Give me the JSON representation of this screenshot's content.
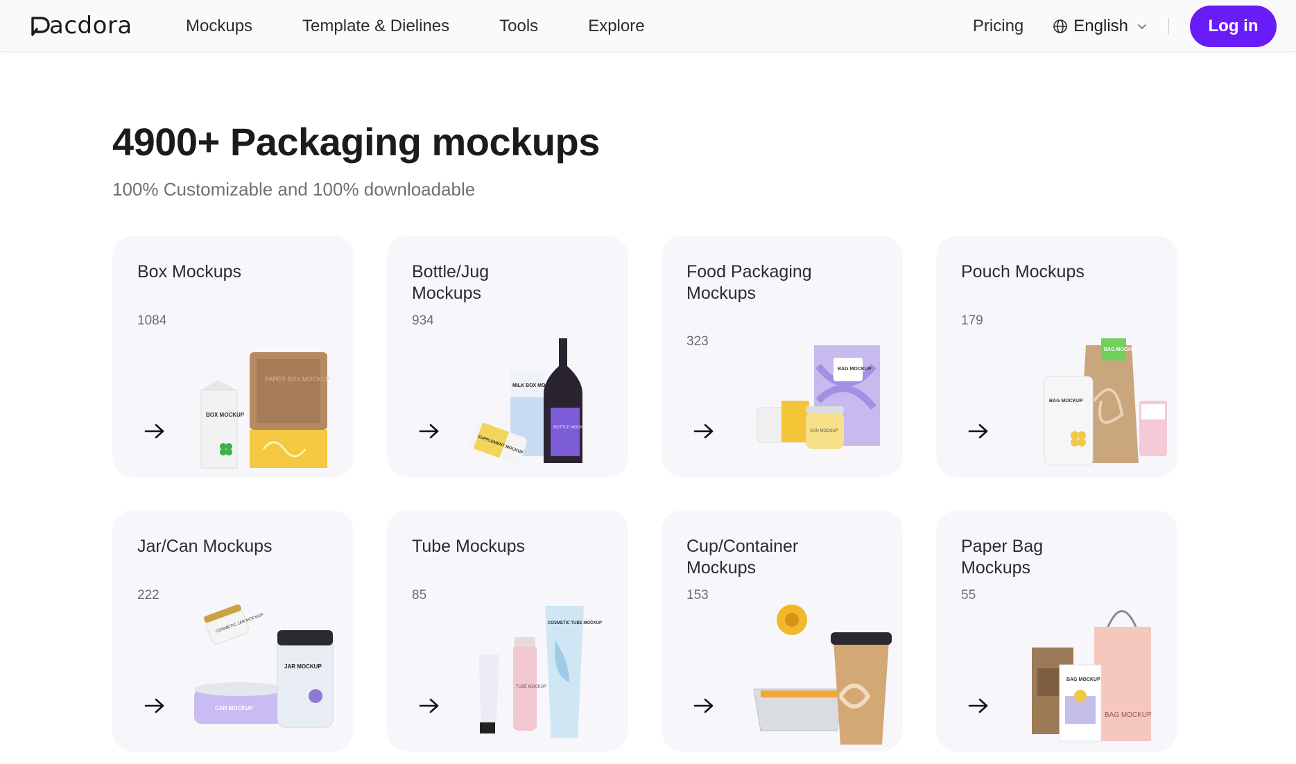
{
  "brand": {
    "name": "acdora",
    "accent": "#6a1cf6"
  },
  "nav": {
    "links": [
      "Mockups",
      "Template & Dielines",
      "Tools",
      "Explore"
    ],
    "pricing": "Pricing",
    "language": "English",
    "login": "Log in"
  },
  "hero": {
    "title": "4900+ Packaging mockups",
    "subtitle": "100% Customizable and 100% downloadable"
  },
  "categories": [
    {
      "title": "Box Mockups",
      "count": "1084",
      "icon": "box-mockup-art"
    },
    {
      "title": "Bottle/Jug Mockups",
      "count": "934",
      "icon": "bottle-mockup-art"
    },
    {
      "title": "Food Packaging Mockups",
      "count": "323",
      "icon": "food-packaging-art"
    },
    {
      "title": "Pouch Mockups",
      "count": "179",
      "icon": "pouch-mockup-art"
    },
    {
      "title": "Jar/Can Mockups",
      "count": "222",
      "icon": "jar-can-art"
    },
    {
      "title": "Tube Mockups",
      "count": "85",
      "icon": "tube-mockup-art"
    },
    {
      "title": "Cup/Container Mockups",
      "count": "153",
      "icon": "cup-container-art"
    },
    {
      "title": "Paper Bag Mockups",
      "count": "55",
      "icon": "paper-bag-art"
    }
  ],
  "art_labels": {
    "paper_box": "PAPER BOX MOCKUP",
    "box": "BOX MOCKUP",
    "milk_box": "MILK BOX MOCKUP",
    "bottle": "BOTTLE MOCKUP",
    "supplement": "SUPPLEMENT MOCKUP",
    "bag": "BAG MOCKUP",
    "can_small": "CAN MOCKUP",
    "can": "CAN MOCKUP",
    "jar": "JAR MOCKUP",
    "cosmetic_jar": "COSMETIC JAR MOCKUP",
    "cosmetic_tube": "COSMETIC TUBE MOCKUP",
    "tube": "TUBE MOCKUP"
  }
}
